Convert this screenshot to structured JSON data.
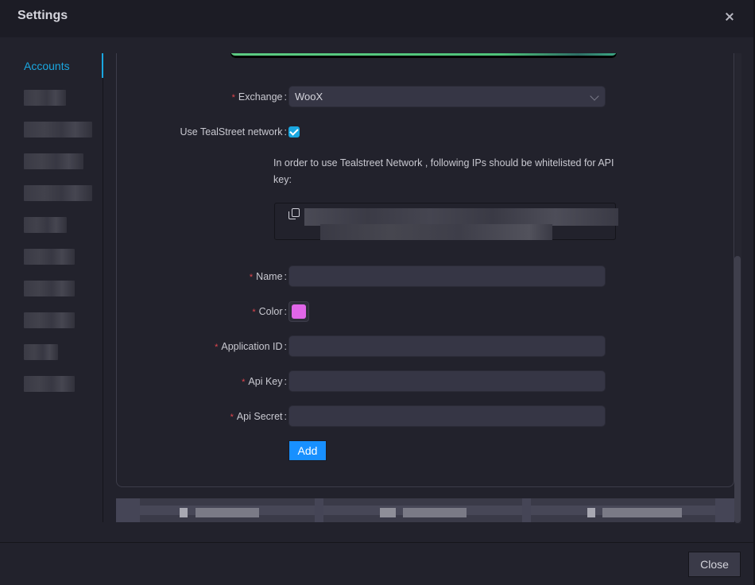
{
  "dialog": {
    "title": "Settings",
    "close_icon": "close-icon"
  },
  "sidebar": {
    "items": [
      {
        "label": "Accounts",
        "active": true
      },
      {
        "label": "[redacted]",
        "redacted": true
      },
      {
        "label": "[redacted]",
        "redacted": true
      },
      {
        "label": "[redacted]",
        "redacted": true
      },
      {
        "label": "[redacted]",
        "redacted": true
      },
      {
        "label": "[redacted]",
        "redacted": true
      },
      {
        "label": "[redacted]",
        "redacted": true
      },
      {
        "label": "[redacted]",
        "redacted": true
      },
      {
        "label": "[redacted]",
        "redacted": true
      },
      {
        "label": "[redacted]",
        "redacted": true
      },
      {
        "label": "[redacted]",
        "redacted": true
      }
    ]
  },
  "form": {
    "exchange": {
      "label": "Exchange",
      "required": true,
      "value": "WooX"
    },
    "use_network": {
      "label": "Use TealStreet network",
      "checked": true
    },
    "network_info": "In order to use Tealstreet Network , following IPs should be whitelisted for API key:",
    "ip_list": "[redacted]",
    "name": {
      "label": "Name",
      "required": true,
      "value": "",
      "placeholder": ""
    },
    "color": {
      "label": "Color",
      "required": true,
      "value": "#e066e8"
    },
    "application_id": {
      "label": "Application ID",
      "required": true,
      "value": "",
      "placeholder": ""
    },
    "api_key": {
      "label": "Api Key",
      "required": true,
      "value": "",
      "placeholder": ""
    },
    "api_secret": {
      "label": "Api Secret",
      "required": true,
      "value": "",
      "placeholder": ""
    },
    "add_label": "Add",
    "required_mark": "*",
    "colon": ":"
  },
  "account_tabs": [
    {
      "label": "[redacted]"
    },
    {
      "label": "[redacted]"
    },
    {
      "label": "[redacted]"
    }
  ],
  "footer": {
    "close_label": "Close"
  },
  "colors": {
    "accent": "#1aa7e0",
    "primary_button": "#1890ff",
    "required": "#e0464e",
    "banner_green": "#5ccb82"
  }
}
